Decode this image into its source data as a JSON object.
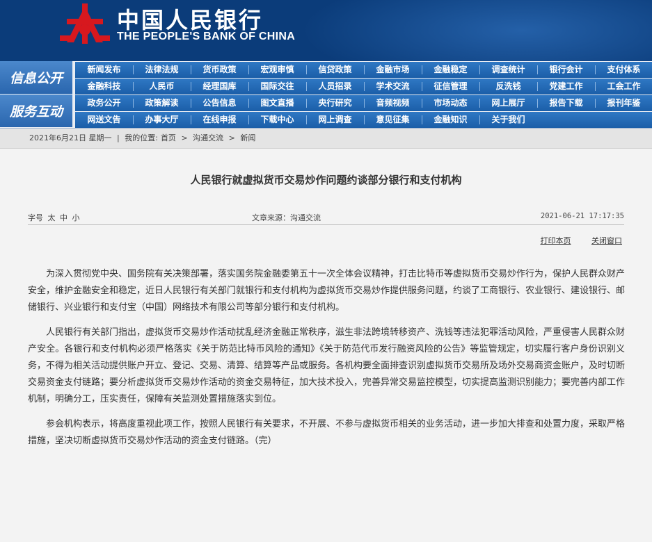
{
  "header": {
    "title_cn": "中国人民银行",
    "title_en": "THE PEOPLE'S BANK OF CHINA",
    "logo_icon": "pboc-emblem-icon",
    "colors": {
      "bg": "#0b3c7a",
      "logo": "#d7181e",
      "nav": "#1b5ea8"
    }
  },
  "nav": {
    "section1_label": "信息公开",
    "section2_label": "服务互动",
    "row1": [
      "新闻发布",
      "法律法规",
      "货币政策",
      "宏观审慎",
      "信贷政策",
      "金融市场",
      "金融稳定",
      "调查统计",
      "银行会计",
      "支付体系"
    ],
    "row2": [
      "金融科技",
      "人民币",
      "经理国库",
      "国际交往",
      "人员招录",
      "学术交流",
      "征信管理",
      "反洗钱",
      "党建工作",
      "工会工作"
    ],
    "row3": [
      "政务公开",
      "政策解读",
      "公告信息",
      "图文直播",
      "央行研究",
      "音频视频",
      "市场动态",
      "网上展厅",
      "报告下载",
      "报刊年鉴"
    ],
    "row4": [
      "网送文告",
      "办事大厅",
      "在线申报",
      "下载中心",
      "网上调查",
      "意见征集",
      "金融知识",
      "关于我们"
    ]
  },
  "crumb": {
    "date": "2021年6月21日 星期一",
    "sep": "|",
    "location": "我的位置:",
    "home": "首页",
    "arrow": ">",
    "section": "沟通交流",
    "current": "新闻"
  },
  "article": {
    "title": "人民银行就虚拟货币交易炒作问题约谈部分银行和支付机构",
    "font_label": "字号",
    "font_large": "太",
    "font_medium": "中",
    "font_small": "小",
    "source": "文章来源：沟通交流",
    "datetime": "2021-06-21 17:17:35",
    "print": "打印本页",
    "close": "关闭窗口",
    "paragraphs": [
      "为深入贯彻党中央、国务院有关决策部署，落实国务院金融委第五十一次全体会议精神，打击比特币等虚拟货币交易炒作行为，保护人民群众财产安全，维护金融安全和稳定，近日人民银行有关部门就银行和支付机构为虚拟货币交易炒作提供服务问题，约谈了工商银行、农业银行、建设银行、邮储银行、兴业银行和支付宝（中国）网络技术有限公司等部分银行和支付机构。",
      "人民银行有关部门指出，虚拟货币交易炒作活动扰乱经济金融正常秩序，滋生非法跨境转移资产、洗钱等违法犯罪活动风险，严重侵害人民群众财产安全。各银行和支付机构必须严格落实《关于防范比特币风险的通知》《关于防范代币发行融资风险的公告》等监管规定，切实履行客户身份识别义务，不得为相关活动提供账户开立、登记、交易、清算、结算等产品或服务。各机构要全面排查识别虚拟货币交易所及场外交易商资金账户，及时切断交易资金支付链路；要分析虚拟货币交易炒作活动的资金交易特征，加大技术投入，完善异常交易监控模型，切实提高监测识别能力；要完善内部工作机制，明确分工，压实责任，保障有关监测处置措施落实到位。",
      "参会机构表示，将高度重视此项工作，按照人民银行有关要求，不开展、不参与虚拟货币相关的业务活动，进一步加大排查和处置力度，采取严格措施，坚决切断虚拟货币交易炒作活动的资金支付链路。（完）"
    ]
  }
}
